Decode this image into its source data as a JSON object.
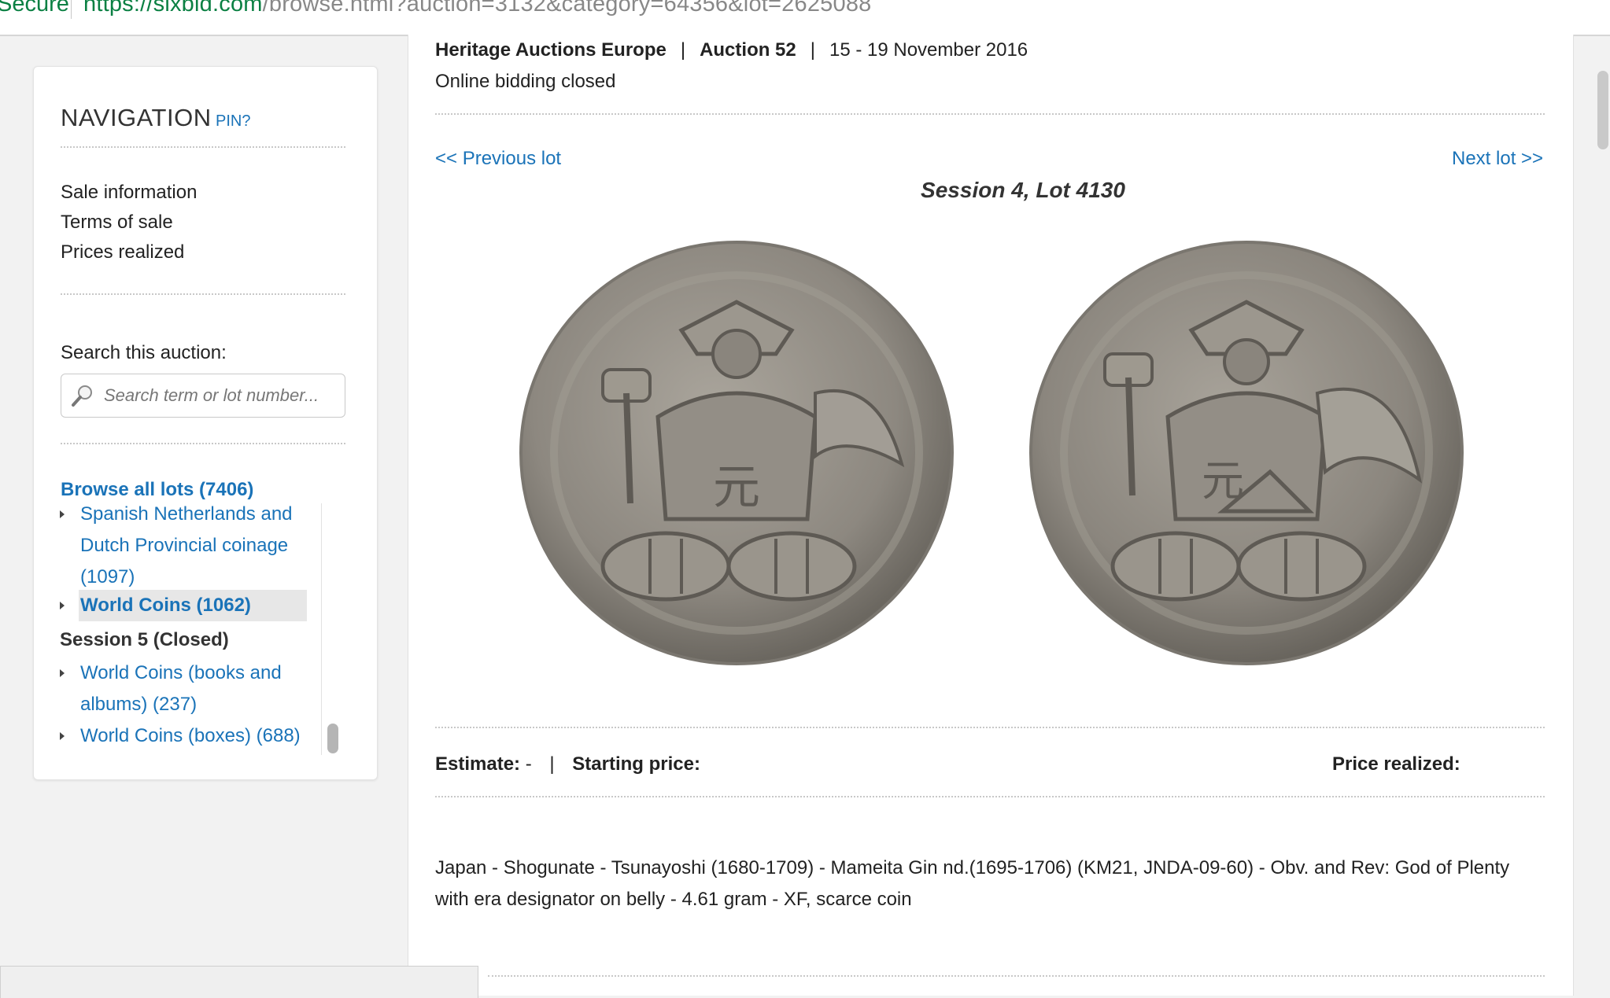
{
  "browser": {
    "secure_label": "Secure",
    "url_scheme_host": "https://sixbid.com",
    "url_path": "/browse.html?auction=3132&category=64356&lot=2625088"
  },
  "nav": {
    "title": "NAVIGATION",
    "pin_label": "PIN?",
    "links": [
      "Sale information",
      "Terms of sale",
      "Prices realized"
    ],
    "search_label": "Search this auction:",
    "search_placeholder": "Search term or lot number...",
    "browse_all": "Browse all lots (7406)",
    "categories": [
      {
        "label": "Spanish Netherlands and Dutch Provincial coinage (1097)",
        "active": false
      },
      {
        "label": "World Coins (1062)",
        "active": true
      }
    ],
    "session5": {
      "title": "Session 5 (Closed)",
      "categories": [
        {
          "label": "World Coins (books and albums) (237)"
        },
        {
          "label": "World Coins (boxes) (688)"
        }
      ]
    }
  },
  "auction": {
    "house": "Heritage Auctions Europe",
    "name": "Auction 52",
    "dates": "15 - 19 November 2016",
    "status": "Online bidding closed"
  },
  "lot": {
    "prev_label": "<< Previous lot",
    "next_label": "Next lot >>",
    "title": "Session 4, Lot 4130",
    "estimate_label": "Estimate:",
    "estimate_value": "-",
    "starting_price_label": "Starting price:",
    "price_realized_label": "Price realized:",
    "description_line1": "Japan - Shogunate - Tsunayoshi (1680-1709) - Mameita Gin nd.(1695-1706) (KM21, JNDA-09-60) - Obv. and Rev: God of Plenty",
    "description_line2": "with era designator on belly - 4.61 gram - XF, scarce coin"
  },
  "colors": {
    "link": "#1a73b8",
    "secure": "#0b8043",
    "coin": "#8f8a82"
  }
}
